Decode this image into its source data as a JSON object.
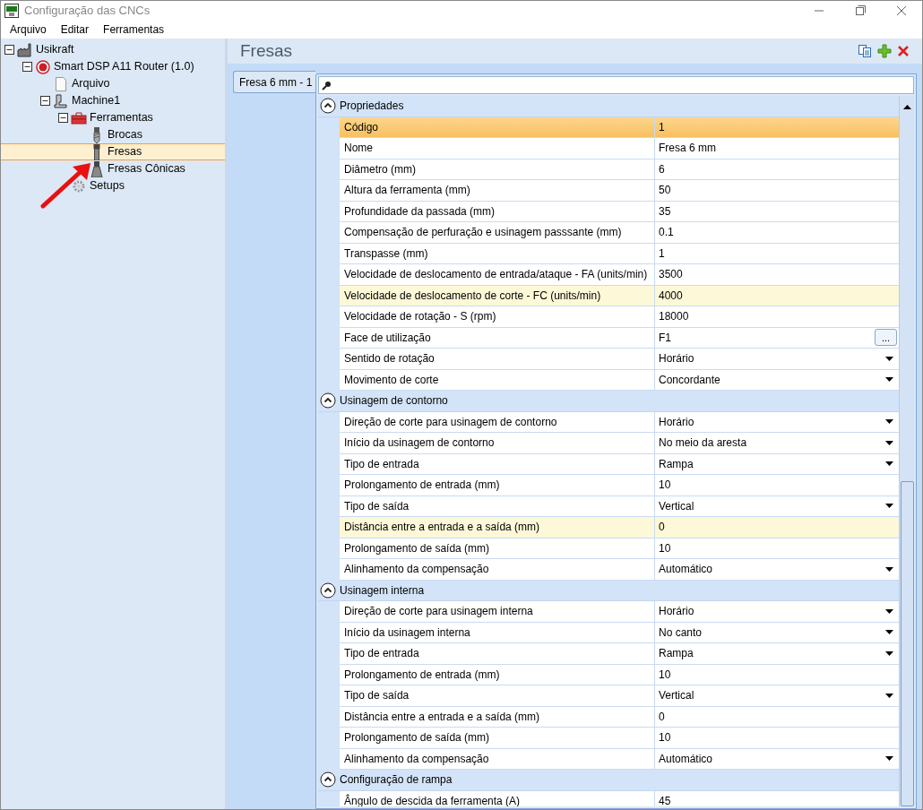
{
  "window": {
    "title": "Configuração das CNCs"
  },
  "menu": [
    "Arquivo",
    "Editar",
    "Ferramentas"
  ],
  "tree": [
    {
      "label": "Usikraft",
      "kind": "factory",
      "expanded": true,
      "selected": false,
      "children": [
        {
          "label": "Smart DSP A11 Router (1.0)",
          "kind": "controller",
          "expanded": true,
          "selected": false,
          "children": [
            {
              "label": "Arquivo",
              "kind": "file",
              "selected": false
            },
            {
              "label": "Machine1",
              "kind": "machine",
              "expanded": true,
              "selected": false,
              "children": [
                {
                  "label": "Ferramentas",
                  "kind": "toolbox",
                  "expanded": true,
                  "selected": false,
                  "children": [
                    {
                      "label": "Brocas",
                      "kind": "drill",
                      "selected": false
                    },
                    {
                      "label": "Fresas",
                      "kind": "mill",
                      "selected": true
                    },
                    {
                      "label": "Fresas Cônicas",
                      "kind": "cone",
                      "selected": false
                    }
                  ]
                },
                {
                  "label": "Setups",
                  "kind": "gear",
                  "selected": false
                }
              ]
            }
          ]
        }
      ]
    }
  ],
  "panel": {
    "title": "Fresas",
    "tabs": [
      {
        "label": "Fresa 6 mm - 1",
        "selected": true
      }
    ]
  },
  "sections": [
    {
      "title": "Propriedades",
      "expanded": true,
      "rows": [
        {
          "label": "Código",
          "value": "1",
          "kind": "text",
          "selected": true,
          "highlighted": false
        },
        {
          "label": "Nome",
          "value": "Fresa 6 mm",
          "kind": "text",
          "selected": false,
          "highlighted": false
        },
        {
          "label": "Diâmetro (mm)",
          "value": "6",
          "kind": "text",
          "selected": false,
          "highlighted": false
        },
        {
          "label": "Altura da ferramenta (mm)",
          "value": "50",
          "kind": "text",
          "selected": false,
          "highlighted": false
        },
        {
          "label": "Profundidade da passada (mm)",
          "value": "35",
          "kind": "text",
          "selected": false,
          "highlighted": false
        },
        {
          "label": "Compensação de perfuração e usinagem passsante (mm)",
          "value": "0.1",
          "kind": "text",
          "selected": false,
          "highlighted": false
        },
        {
          "label": "Transpasse (mm)",
          "value": "1",
          "kind": "text",
          "selected": false,
          "highlighted": false
        },
        {
          "label": "Velocidade de deslocamento de entrada/ataque - FA (units/min)",
          "value": "3500",
          "kind": "text",
          "selected": false,
          "highlighted": false
        },
        {
          "label": "Velocidade de deslocamento de corte - FC (units/min)",
          "value": "4000",
          "kind": "text",
          "selected": false,
          "highlighted": true
        },
        {
          "label": "Velocidade de rotação - S (rpm)",
          "value": "18000",
          "kind": "text",
          "selected": false,
          "highlighted": false
        },
        {
          "label": "Face de utilização",
          "value": "F1",
          "kind": "button",
          "button": "...",
          "selected": false,
          "highlighted": false
        },
        {
          "label": "Sentido de rotação",
          "value": "Horário",
          "kind": "dropdown",
          "selected": false,
          "highlighted": false
        },
        {
          "label": "Movimento de corte",
          "value": "Concordante",
          "kind": "dropdown",
          "selected": false,
          "highlighted": false
        }
      ]
    },
    {
      "title": "Usinagem de contorno",
      "expanded": true,
      "rows": [
        {
          "label": "Direção de corte para usinagem de contorno",
          "value": "Horário",
          "kind": "dropdown",
          "selected": false,
          "highlighted": false
        },
        {
          "label": "Início da usinagem de contorno",
          "value": "No meio da aresta",
          "kind": "dropdown",
          "selected": false,
          "highlighted": false
        },
        {
          "label": "Tipo de entrada",
          "value": "Rampa",
          "kind": "dropdown",
          "selected": false,
          "highlighted": false
        },
        {
          "label": "Prolongamento de entrada (mm)",
          "value": "10",
          "kind": "text",
          "selected": false,
          "highlighted": false
        },
        {
          "label": "Tipo de saída",
          "value": "Vertical",
          "kind": "dropdown",
          "selected": false,
          "highlighted": false
        },
        {
          "label": "Distância entre a entrada e a saída (mm)",
          "value": "0",
          "kind": "text",
          "selected": false,
          "highlighted": true
        },
        {
          "label": "Prolongamento de saída (mm)",
          "value": "10",
          "kind": "text",
          "selected": false,
          "highlighted": false
        },
        {
          "label": "Alinhamento da compensação",
          "value": "Automático",
          "kind": "dropdown",
          "selected": false,
          "highlighted": false
        }
      ]
    },
    {
      "title": "Usinagem interna",
      "expanded": true,
      "rows": [
        {
          "label": "Direção de corte para usinagem interna",
          "value": "Horário",
          "kind": "dropdown",
          "selected": false,
          "highlighted": false
        },
        {
          "label": "Início da usinagem interna",
          "value": "No canto",
          "kind": "dropdown",
          "selected": false,
          "highlighted": false
        },
        {
          "label": "Tipo de entrada",
          "value": "Rampa",
          "kind": "dropdown",
          "selected": false,
          "highlighted": false
        },
        {
          "label": "Prolongamento de entrada (mm)",
          "value": "10",
          "kind": "text",
          "selected": false,
          "highlighted": false
        },
        {
          "label": "Tipo de saída",
          "value": "Vertical",
          "kind": "dropdown",
          "selected": false,
          "highlighted": false
        },
        {
          "label": "Distância entre a entrada e a saída (mm)",
          "value": "0",
          "kind": "text",
          "selected": false,
          "highlighted": false
        },
        {
          "label": "Prolongamento de saída (mm)",
          "value": "10",
          "kind": "text",
          "selected": false,
          "highlighted": false
        },
        {
          "label": "Alinhamento da compensação",
          "value": "Automático",
          "kind": "dropdown",
          "selected": false,
          "highlighted": false
        }
      ]
    },
    {
      "title": "Configuração de rampa",
      "expanded": true,
      "rows": [
        {
          "label": "Ângulo de descida da ferramenta (A)",
          "value": "45",
          "kind": "text",
          "selected": false,
          "highlighted": false
        }
      ]
    }
  ]
}
